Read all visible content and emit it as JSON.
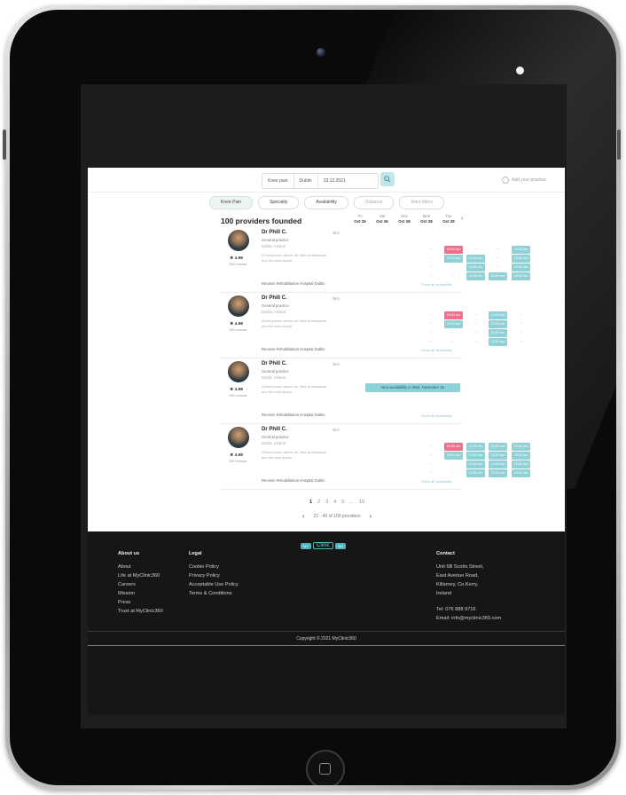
{
  "search": {
    "fields": [
      "Knee pain",
      "Dublin",
      "23.12.2021"
    ],
    "add_practice": "Add your practice"
  },
  "filters": [
    "Knee Pain",
    "Specialty",
    "Availability",
    "Distance",
    "More filters"
  ],
  "results": {
    "title": "100 providers founded",
    "days": [
      {
        "day": "Fri",
        "date": "Oct 25"
      },
      {
        "day": "Sat",
        "date": "Oct 26"
      },
      {
        "day": "Sun",
        "date": "Oct 28"
      },
      {
        "day": "Mon",
        "date": "Oct 28"
      },
      {
        "day": "Tue",
        "date": "Oct 29"
      }
    ],
    "next_arrow": "›"
  },
  "providers": [
    {
      "name": "Dr Phill C.",
      "distance": "3km",
      "specialty": "General practice",
      "location": "Dublin, Ireland",
      "description": "Great person above all. Nice professional and the best doctor",
      "rating": "★ 4.98",
      "reviews": "250 reviews",
      "hospital": "Reunion Rehabilitation Hospital Dublin",
      "show_all": "Show all availability",
      "slots": [
        [
          "dash",
          "pink",
          "dash",
          "dash",
          "teal"
        ],
        [
          "dash",
          "teal",
          "teal",
          "dash",
          "teal"
        ],
        [
          "dash",
          "dash",
          "teal",
          "dash",
          "teal"
        ],
        [
          "dash",
          "dash",
          "teal",
          "teal",
          "teal"
        ]
      ]
    },
    {
      "name": "Dr Phill C.",
      "distance": "3km",
      "specialty": "General practice",
      "location": "Dublin, Ireland",
      "description": "Great person above all. Nice professional and the best doctor",
      "rating": "★ 4.98",
      "reviews": "250 reviews",
      "hospital": "Reunion Rehabilitation Hospital Dublin",
      "show_all": "Show all availability",
      "slots": [
        [
          "dash",
          "pink",
          "dash",
          "teal",
          "dash"
        ],
        [
          "dash",
          "teal",
          "dash",
          "teal",
          "dash"
        ],
        [
          "dash",
          "dash",
          "dash",
          "teal",
          "dash"
        ],
        [
          "dash",
          "dash",
          "dash",
          "teal",
          "dash"
        ]
      ]
    },
    {
      "name": "Dr Phill C.",
      "distance": "3km",
      "specialty": "General practice",
      "location": "Dublin, Ireland",
      "description": "Great person above all. Nice professional and the best doctor",
      "rating": "★ 4.98",
      "reviews": "250 reviews",
      "hospital": "Reunion Rehabilitation Hospital Dublin",
      "show_all": "Show all availability",
      "next_availability": "Next availability in Wed, November 15",
      "slots": []
    },
    {
      "name": "Dr Phill C.",
      "distance": "3km",
      "specialty": "General practice",
      "location": "Dublin, Ireland",
      "description": "Great person above all. Nice professional and the best doctor",
      "rating": "★ 4.98",
      "reviews": "250 reviews",
      "hospital": "Reunion Rehabilitation Hospital Dublin",
      "show_all": "Show all availability",
      "slots": [
        [
          "dash",
          "pink",
          "teal",
          "teal",
          "teal"
        ],
        [
          "dash",
          "teal",
          "teal",
          "teal",
          "teal"
        ],
        [
          "dash",
          "dash",
          "teal",
          "teal",
          "teal"
        ],
        [
          "dash",
          "dash",
          "teal",
          "teal",
          "teal"
        ]
      ]
    }
  ],
  "slot_label": "10:00 am",
  "pagination": {
    "pages": [
      "1",
      "2",
      "3",
      "4",
      "5",
      "...",
      "10"
    ],
    "current": "1",
    "summary": "21 - 40 of 100 providers",
    "prev": "‹",
    "next": "›"
  },
  "footer": {
    "logo": {
      "left": "MY",
      "word": "Clinic",
      "right": "360"
    },
    "about": {
      "title": "About us",
      "links": [
        "About",
        "Life at MyClinic360",
        "Careers",
        "Mission",
        "Press",
        "Trust at MyClinic360"
      ]
    },
    "legal": {
      "title": "Legal",
      "links": [
        "Cookie Policy",
        "Privacy Policy",
        "Acceptable Use Policy",
        "Terms & Conditions"
      ]
    },
    "contact": {
      "title": "Contact",
      "address": [
        "Unit 6B Scotts Street,",
        "East Avenue Road,",
        "Killarney, Co.Kerry,",
        "Ireland"
      ],
      "tel": "Tel: 076 888 9716",
      "email": "Email: info@myclinic360.com"
    },
    "copyright": "Copyright © 2021 MyClinic360"
  },
  "colors": {
    "accent": "#8fd1d7",
    "booked": "#ef6f8d",
    "footer": "#161616"
  }
}
